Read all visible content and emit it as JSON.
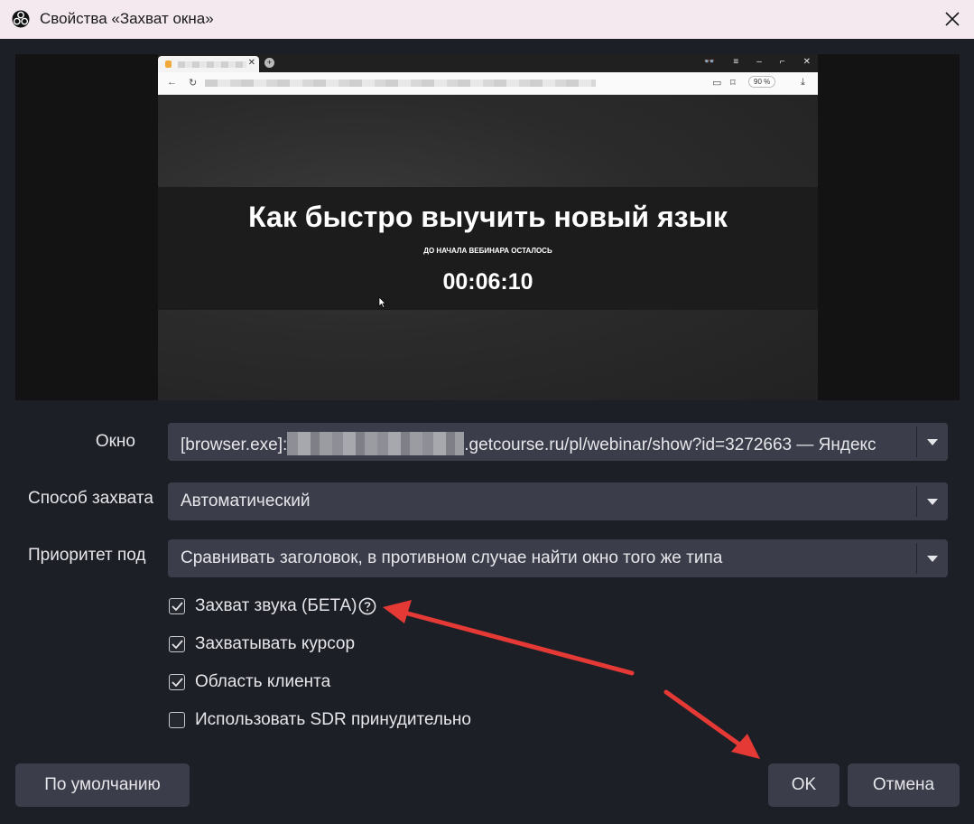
{
  "window": {
    "title": "Свойства «Захват окна»",
    "app_icon": "obs-logo-icon",
    "close_icon": "close-icon"
  },
  "preview": {
    "browser": {
      "zoom": "90 %",
      "headline": "Как быстро выучить новый язык",
      "caption": "ДО НАЧАЛА ВЕБИНАРА ОСТАЛОСЬ",
      "timer": "00:06:10"
    }
  },
  "fields": {
    "window": {
      "label": "Окно",
      "value_prefix": "[browser.exe]:",
      "value_suffix": ".getcourse.ru/pl/webinar/show?id=3272663 — Яндекс"
    },
    "capture_method": {
      "label": "Способ захвата",
      "value": "Автоматический"
    },
    "priority": {
      "label": "Приоритет под",
      "value": "Сравнивать заголовок, в противном случае найти окно того же типа"
    }
  },
  "checkboxes": [
    {
      "label": "Захват звука (БЕТА)",
      "checked": true,
      "help_icon": "help-circle-icon"
    },
    {
      "label": "Захватывать курсор",
      "checked": true
    },
    {
      "label": "Область клиента",
      "checked": true
    },
    {
      "label": "Использовать SDR принудительно",
      "checked": false
    }
  ],
  "buttons": {
    "defaults": "По умолчанию",
    "ok": "OK",
    "cancel": "Отмена"
  },
  "colors": {
    "dialog_bg": "#1d1f26",
    "titlebar_bg": "#f4e9ee",
    "control_bg": "#3b3e4a",
    "annotation_arrow": "#e53935"
  }
}
